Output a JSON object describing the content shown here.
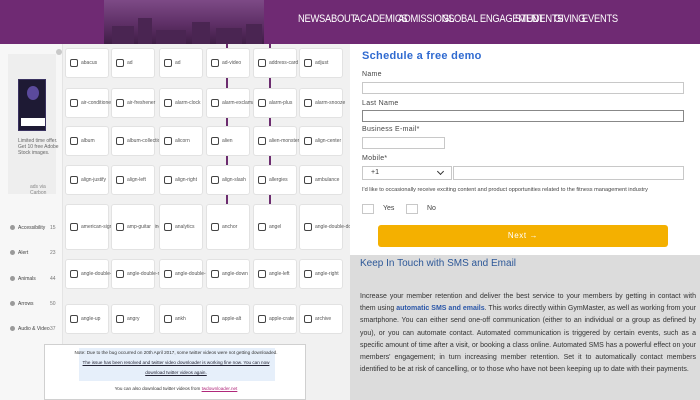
{
  "nav": {
    "items": [
      "NEWS",
      "ABOUT",
      "ACADEMICS",
      "ADMISSIONS",
      "GLOBAL ENGAGEMENT",
      "STUDENTS",
      "GIVING",
      "EVENTS"
    ]
  },
  "icon_panel": {
    "ad": {
      "caption": "Limited time offer. Get 10 free Adobe Stock images.",
      "credit": "ads via Carbon"
    },
    "side_items": [
      {
        "label": "Accessibility",
        "count": "15"
      },
      {
        "label": "Alert",
        "count": "23"
      },
      {
        "label": "Animals",
        "count": "44"
      },
      {
        "label": "Arrows",
        "count": "50"
      },
      {
        "label": "Audio & Video",
        "count": "37"
      }
    ],
    "tiles": [
      [
        "abacus",
        "ad",
        "ad",
        "ad-video",
        "address-card",
        "adjust"
      ],
      [
        "air-conditioner",
        "air-freshener",
        "alarm-clock",
        "alarm-exclamation",
        "alarm-plus",
        "alarm-snooze"
      ],
      [
        "album",
        "album-collection",
        "alicorn",
        "alien",
        "alien-monster",
        "align-center"
      ],
      [
        "align-justify",
        "align-left",
        "align-right",
        "align-slash",
        "allergies",
        "ambulance"
      ],
      [
        "american-sign-language-interpreting",
        "amp-guitar",
        "analytics",
        "anchor",
        "angel",
        "angle-double-down"
      ],
      [
        "angle-double-left",
        "angle-double-right",
        "angle-double-up",
        "angle-down",
        "angle-left",
        "angle-right"
      ],
      [
        "angle-up",
        "angry",
        "ankh",
        "apple-alt",
        "apple-crate",
        "archive"
      ]
    ],
    "note": {
      "line1": "Note: Due to the bug occurred on 20th April 2017, some twitter videos were not getting downloaded.",
      "line2": "The issue has been resolved and twitter video downloader is working fine now. You can now",
      "line3": "download twitter videos again.",
      "line4_prefix": "You can also download twitter videos from",
      "line4_link": "twdownloader.net"
    }
  },
  "demo_form": {
    "title": "Schedule a free demo",
    "name_label": "Name",
    "lastname_label": "Last Name",
    "email_label": "Business E-mail*",
    "mobile_label": "Mobile*",
    "country_code": "+1",
    "optin_text": "I'd like to occasionally receive exciting content and product opportunities related to the fitness management industry",
    "yes_label": "Yes",
    "no_label": "No",
    "next_label": "Next  →"
  },
  "sms": {
    "title": "Keep In Touch with SMS and Email",
    "body_part1": "Increase your member retention and deliver the best service to your members by getting in contact with them using ",
    "body_highlight": "automatic SMS and emails",
    "body_part2": ". This works directly within GymMaster, as well as working from your smartphone. You can either send one-off communication (either to an individual or a group as defined by you), or you can automate contact. Automated communication is triggered by certain events, such as a specific amount of time after a visit, or booking a class online. Automated SMS has a powerful effect on your members' engagement; in turn increasing member retention. Set it to automatically contact members identified to be at risk of cancelling, or to those who have not been keeping up to date with their payments."
  },
  "colors": {
    "banner": "#6f2a73",
    "form_title": "#2f6ad0",
    "next_button": "#f4b000",
    "sms_title": "#2d5898",
    "sms_panel_bg": "#dcdcdc"
  }
}
